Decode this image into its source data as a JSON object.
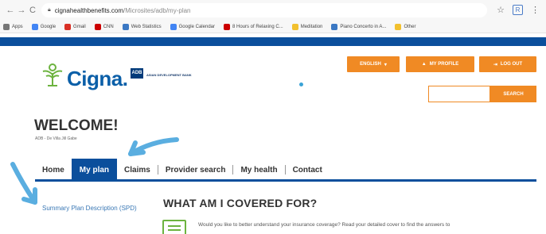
{
  "browser": {
    "back_glyph": "←",
    "forward_glyph": "→",
    "reload_glyph": "C",
    "url_host": "cignahealthbenefits.com",
    "url_path": "/Microsites/adb/my-plan",
    "star_glyph": "☆",
    "ext_label": "R",
    "menu_glyph": "⋮"
  },
  "bookmarks": [
    {
      "label": "Apps",
      "color": "#777777"
    },
    {
      "label": "Google",
      "color": "#4285f4"
    },
    {
      "label": "Gmail",
      "color": "#d93025"
    },
    {
      "label": "CNN",
      "color": "#cc0000"
    },
    {
      "label": "Web Statistics",
      "color": "#3b78c3"
    },
    {
      "label": "Google Calendar",
      "color": "#4285f4"
    },
    {
      "label": "8 Hours of Relaxing C...",
      "color": "#cc0000"
    },
    {
      "label": "Meditation",
      "color": "#f2c02e"
    },
    {
      "label": "Piano Concerto in A...",
      "color": "#3b78c3"
    },
    {
      "label": "Other",
      "color": "#f2c02e"
    }
  ],
  "site": {
    "logo_text": "Cigna.",
    "partner_badge": "ADB",
    "partner_name": "ASIAN DEVELOPMENT BANK",
    "language_button": "ENGLISH",
    "profile_button": "MY PROFILE",
    "logout_button": "LOG OUT",
    "search_placeholder": "",
    "search_button": "SEARCH",
    "welcome_title": "WELCOME!",
    "welcome_sub": "ADB - De Villa Jill Gabe"
  },
  "nav": {
    "items": [
      {
        "label": "Home"
      },
      {
        "label": "My plan"
      },
      {
        "label": "Claims"
      },
      {
        "label": "Provider search"
      },
      {
        "label": "My health"
      },
      {
        "label": "Contact"
      }
    ]
  },
  "content": {
    "side_link": "Summary Plan Description (SPD)",
    "heading": "WHAT AM I COVERED FOR?",
    "body_text": "Would you like to better understand your insurance coverage? Read your detailed cover to find the answers to"
  },
  "colors": {
    "brand_blue": "#0b4f9c",
    "accent_orange": "#f08a24",
    "logo_green": "#6cb33f",
    "annotation_arrow": "#5aaee0"
  }
}
